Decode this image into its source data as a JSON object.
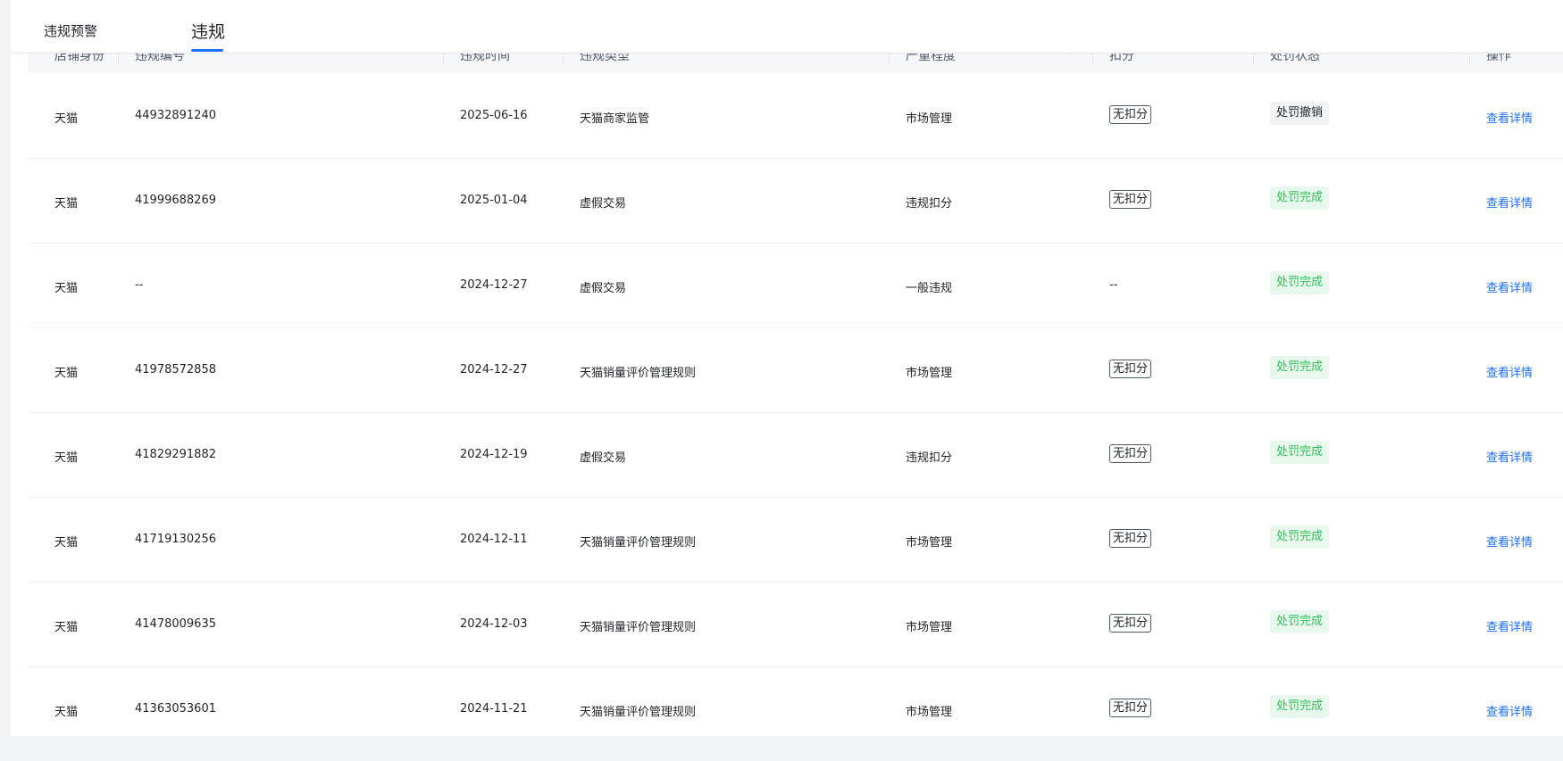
{
  "tabs": [
    {
      "label": "违规预警",
      "active": false
    },
    {
      "label": "违规",
      "active": true
    }
  ],
  "table": {
    "columns": [
      "店铺身份",
      "违规编号",
      "违规时间",
      "违规类型",
      "严重程度",
      "扣分",
      "处罚状态",
      "操作"
    ],
    "rows": [
      {
        "shop": "天猫",
        "id": "44932891240",
        "date": "2025-06-16",
        "type": "天猫商家监管",
        "severity": "市场管理",
        "score": "无扣分",
        "status": "处罚撤销",
        "status_kind": "revoked",
        "action": "查看详情"
      },
      {
        "shop": "天猫",
        "id": "41999688269",
        "date": "2025-01-04",
        "type": "虚假交易",
        "severity": "违规扣分",
        "score": "无扣分",
        "status": "处罚完成",
        "status_kind": "done",
        "action": "查看详情"
      },
      {
        "shop": "天猫",
        "id": "--",
        "date": "2024-12-27",
        "type": "虚假交易",
        "severity": "一般违规",
        "score": "--",
        "status": "处罚完成",
        "status_kind": "done",
        "action": "查看详情"
      },
      {
        "shop": "天猫",
        "id": "41978572858",
        "date": "2024-12-27",
        "type": "天猫销量评价管理规则",
        "severity": "市场管理",
        "score": "无扣分",
        "status": "处罚完成",
        "status_kind": "done",
        "action": "查看详情"
      },
      {
        "shop": "天猫",
        "id": "41829291882",
        "date": "2024-12-19",
        "type": "虚假交易",
        "severity": "违规扣分",
        "score": "无扣分",
        "status": "处罚完成",
        "status_kind": "done",
        "action": "查看详情"
      },
      {
        "shop": "天猫",
        "id": "41719130256",
        "date": "2024-12-11",
        "type": "天猫销量评价管理规则",
        "severity": "市场管理",
        "score": "无扣分",
        "status": "处罚完成",
        "status_kind": "done",
        "action": "查看详情"
      },
      {
        "shop": "天猫",
        "id": "41478009635",
        "date": "2024-12-03",
        "type": "天猫销量评价管理规则",
        "severity": "市场管理",
        "score": "无扣分",
        "status": "处罚完成",
        "status_kind": "done",
        "action": "查看详情"
      },
      {
        "shop": "天猫",
        "id": "41363053601",
        "date": "2024-11-21",
        "type": "天猫销量评价管理规则",
        "severity": "市场管理",
        "score": "无扣分",
        "status": "处罚完成",
        "status_kind": "done",
        "action": "查看详情"
      }
    ]
  },
  "colors": {
    "accent": "#1f6fff",
    "success_text": "#2fbf5b",
    "success_bg": "#e8f8ec",
    "neutral_bg": "#f2f3f5"
  }
}
